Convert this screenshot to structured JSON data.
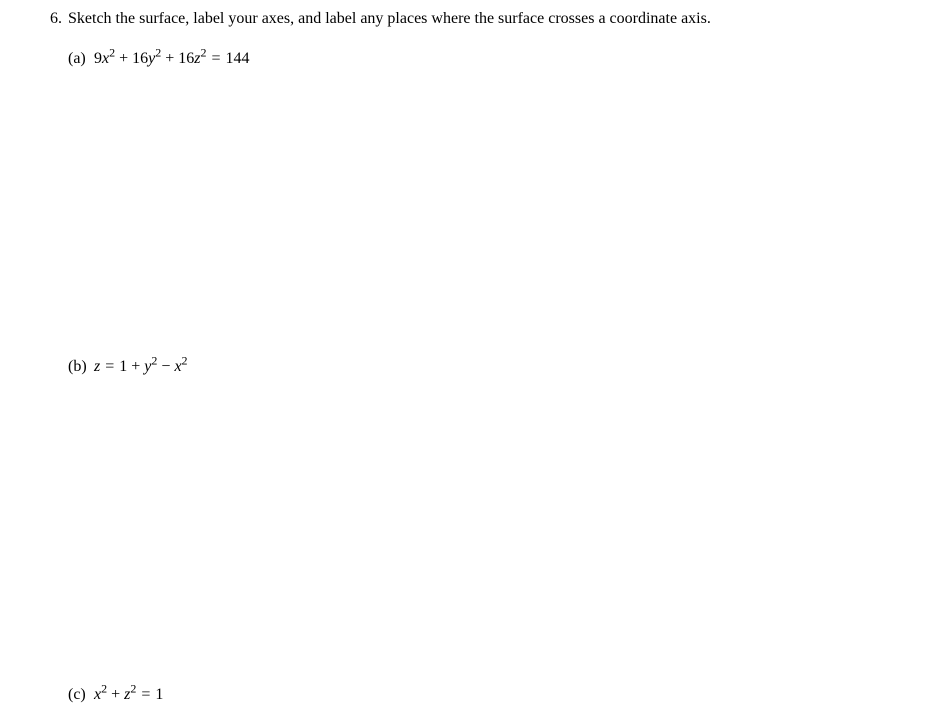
{
  "problem": {
    "number": "6.",
    "text": "Sketch the surface, label your axes, and label any places where the surface crosses a coordinate axis."
  },
  "parts": {
    "a": {
      "label": "(a)",
      "coef1": "9",
      "var1": "x",
      "coef2": "16",
      "var2": "y",
      "coef3": "16",
      "var3": "z",
      "rhs": "144",
      "plus": "+",
      "eq": "="
    },
    "b": {
      "label": "(b)",
      "lhs_var": "z",
      "eq": "=",
      "const": "1",
      "plus": "+",
      "var1": "y",
      "minus": "−",
      "var2": "x"
    },
    "c": {
      "label": "(c)",
      "var1": "x",
      "plus": "+",
      "var2": "z",
      "eq": "=",
      "rhs": "1"
    }
  }
}
